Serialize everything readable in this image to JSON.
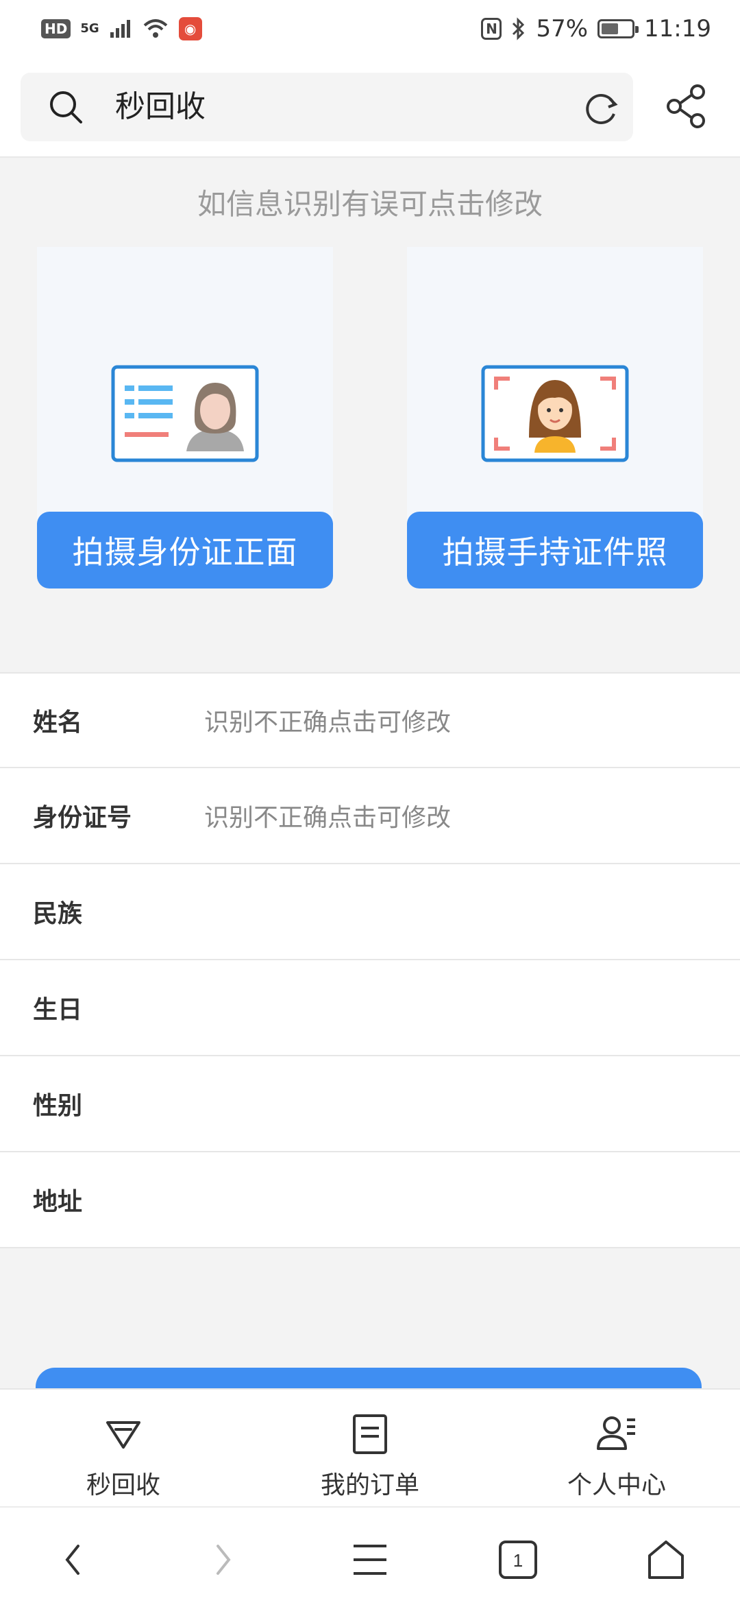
{
  "status_bar": {
    "hd": "HD",
    "network": "5G",
    "battery_percent": "57%",
    "battery_level": 0.57,
    "time": "11:19",
    "nfc": "N"
  },
  "header": {
    "search_text": "秒回收"
  },
  "upload": {
    "hint": "如信息识别有误可点击修改",
    "front_button": "拍摄身份证正面",
    "handheld_button": "拍摄手持证件照"
  },
  "form": {
    "rows": [
      {
        "label": "姓名",
        "value": "识别不正确点击可修改"
      },
      {
        "label": "身份证号",
        "value": "识别不正确点击可修改"
      },
      {
        "label": "民族",
        "value": ""
      },
      {
        "label": "生日",
        "value": ""
      },
      {
        "label": "性别",
        "value": ""
      },
      {
        "label": "地址",
        "value": ""
      }
    ]
  },
  "tabs": [
    {
      "label": "秒回收",
      "icon": "diamond-icon"
    },
    {
      "label": "我的订单",
      "icon": "order-list-icon"
    },
    {
      "label": "个人中心",
      "icon": "user-profile-icon"
    }
  ],
  "browser_nav": {
    "tab_count": "1"
  },
  "colors": {
    "accent": "#3f8ef2",
    "card_bg": "#f4f7fb"
  }
}
